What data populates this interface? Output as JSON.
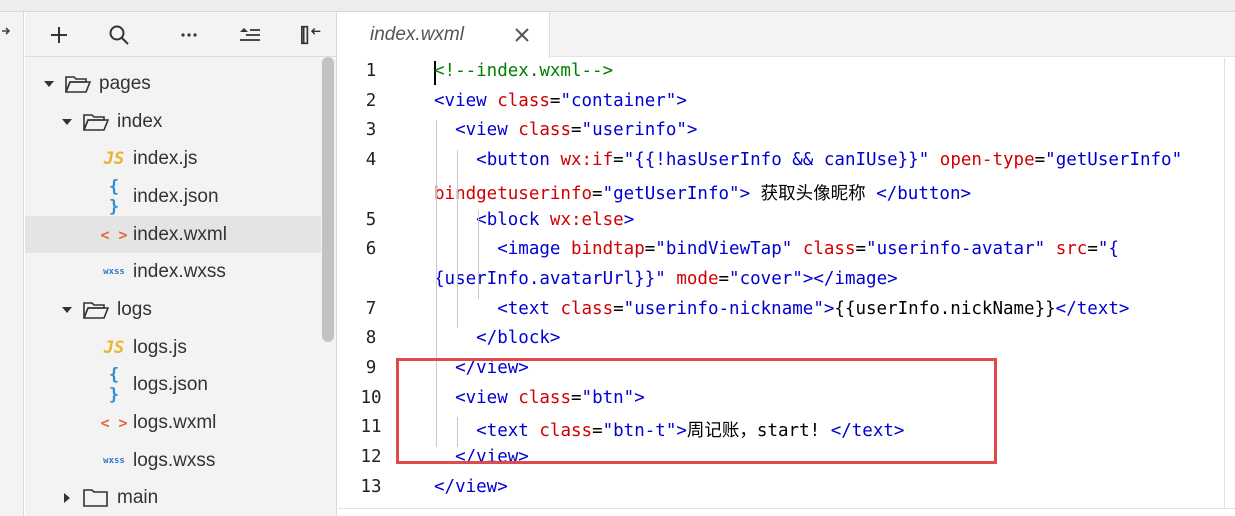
{
  "toolbar": {
    "icons": [
      "add-icon",
      "search-icon",
      "more-icon",
      "collapse-all-icon",
      "panel-collapse-icon"
    ]
  },
  "explorer": {
    "tree": [
      {
        "name": "pages",
        "type": "folder",
        "expanded": true,
        "depth": 0
      },
      {
        "name": "index",
        "type": "folder",
        "expanded": true,
        "depth": 1
      },
      {
        "name": "index.js",
        "type": "file",
        "icon": "JS",
        "kind": "js",
        "depth": 2
      },
      {
        "name": "index.json",
        "type": "file",
        "icon": "{ }",
        "kind": "json",
        "depth": 2
      },
      {
        "name": "index.wxml",
        "type": "file",
        "icon": "< >",
        "kind": "wxml",
        "depth": 2,
        "selected": true
      },
      {
        "name": "index.wxss",
        "type": "file",
        "icon": "wxss",
        "kind": "wxss",
        "depth": 2
      },
      {
        "name": "logs",
        "type": "folder",
        "expanded": true,
        "depth": 1
      },
      {
        "name": "logs.js",
        "type": "file",
        "icon": "JS",
        "kind": "js",
        "depth": 2
      },
      {
        "name": "logs.json",
        "type": "file",
        "icon": "{ }",
        "kind": "json",
        "depth": 2
      },
      {
        "name": "logs.wxml",
        "type": "file",
        "icon": "< >",
        "kind": "wxml",
        "depth": 2
      },
      {
        "name": "logs.wxss",
        "type": "file",
        "icon": "wxss",
        "kind": "wxss",
        "depth": 2
      },
      {
        "name": "main",
        "type": "folder",
        "expanded": false,
        "depth": 1
      }
    ]
  },
  "editor": {
    "tab": {
      "label": "index.wxml"
    },
    "lines": [
      {
        "num": "1",
        "tokens": [
          [
            "c",
            "<!--index.wxml-->"
          ]
        ]
      },
      {
        "num": "2",
        "tokens": [
          [
            "t",
            "<view "
          ],
          [
            "a",
            "class"
          ],
          [
            "x",
            "="
          ],
          [
            "s",
            "\"container\""
          ],
          [
            "t",
            ">"
          ]
        ]
      },
      {
        "num": "3",
        "tokens": [
          [
            "x",
            "  "
          ],
          [
            "t",
            "<view "
          ],
          [
            "a",
            "class"
          ],
          [
            "x",
            "="
          ],
          [
            "s",
            "\"userinfo\""
          ],
          [
            "t",
            ">"
          ]
        ]
      },
      {
        "num": "4",
        "tokens": [
          [
            "x",
            "    "
          ],
          [
            "t",
            "<button "
          ],
          [
            "a",
            "wx:if"
          ],
          [
            "x",
            "="
          ],
          [
            "s",
            "\"{{!hasUserInfo && canIUse}}\""
          ],
          [
            "x",
            " "
          ],
          [
            "a",
            "open-type"
          ],
          [
            "x",
            "="
          ],
          [
            "s",
            "\"getUserInfo\""
          ]
        ]
      },
      {
        "num": "",
        "tokens": [
          [
            "a",
            "bindgetuserinfo"
          ],
          [
            "x",
            "="
          ],
          [
            "s",
            "\"getUserInfo\""
          ],
          [
            "t",
            ">"
          ],
          [
            "x",
            " 获取头像昵称 "
          ],
          [
            "t",
            "</button>"
          ]
        ]
      },
      {
        "num": "5",
        "tokens": [
          [
            "x",
            "    "
          ],
          [
            "t",
            "<block "
          ],
          [
            "a",
            "wx:else"
          ],
          [
            "t",
            ">"
          ]
        ]
      },
      {
        "num": "6",
        "tokens": [
          [
            "x",
            "      "
          ],
          [
            "t",
            "<image "
          ],
          [
            "a",
            "bindtap"
          ],
          [
            "x",
            "="
          ],
          [
            "s",
            "\"bindViewTap\""
          ],
          [
            "x",
            " "
          ],
          [
            "a",
            "class"
          ],
          [
            "x",
            "="
          ],
          [
            "s",
            "\"userinfo-avatar\""
          ],
          [
            "x",
            " "
          ],
          [
            "a",
            "src"
          ],
          [
            "x",
            "="
          ],
          [
            "s",
            "\"{"
          ]
        ]
      },
      {
        "num": "",
        "tokens": [
          [
            "s",
            "{userInfo.avatarUrl}}\""
          ],
          [
            "x",
            " "
          ],
          [
            "a",
            "mode"
          ],
          [
            "x",
            "="
          ],
          [
            "s",
            "\"cover\""
          ],
          [
            "t",
            "></image>"
          ]
        ]
      },
      {
        "num": "7",
        "tokens": [
          [
            "x",
            "      "
          ],
          [
            "t",
            "<text "
          ],
          [
            "a",
            "class"
          ],
          [
            "x",
            "="
          ],
          [
            "s",
            "\"userinfo-nickname\""
          ],
          [
            "t",
            ">"
          ],
          [
            "x",
            "{{userInfo.nickName}}"
          ],
          [
            "t",
            "</text>"
          ]
        ]
      },
      {
        "num": "8",
        "tokens": [
          [
            "x",
            "    "
          ],
          [
            "t",
            "</block>"
          ]
        ]
      },
      {
        "num": "9",
        "tokens": [
          [
            "x",
            "  "
          ],
          [
            "t",
            "</view>"
          ]
        ]
      },
      {
        "num": "10",
        "tokens": [
          [
            "x",
            "  "
          ],
          [
            "t",
            "<view "
          ],
          [
            "a",
            "class"
          ],
          [
            "x",
            "="
          ],
          [
            "s",
            "\"btn\""
          ],
          [
            "t",
            ">"
          ]
        ]
      },
      {
        "num": "11",
        "tokens": [
          [
            "x",
            "    "
          ],
          [
            "t",
            "<text "
          ],
          [
            "a",
            "class"
          ],
          [
            "x",
            "="
          ],
          [
            "s",
            "\"btn-t\""
          ],
          [
            "t",
            ">"
          ],
          [
            "x",
            "周记账，start! "
          ],
          [
            "t",
            "</text>"
          ]
        ]
      },
      {
        "num": "12",
        "tokens": [
          [
            "x",
            "  "
          ],
          [
            "t",
            "</view>"
          ]
        ]
      },
      {
        "num": "13",
        "tokens": [
          [
            "t",
            "</view>"
          ]
        ]
      }
    ]
  },
  "colors": {
    "tag": "#0000d0",
    "attribute": "#d00000",
    "string": "#0000d0",
    "comment": "#008000",
    "highlight_border": "#e04a4a",
    "selected_row": "#e4e4e4"
  }
}
